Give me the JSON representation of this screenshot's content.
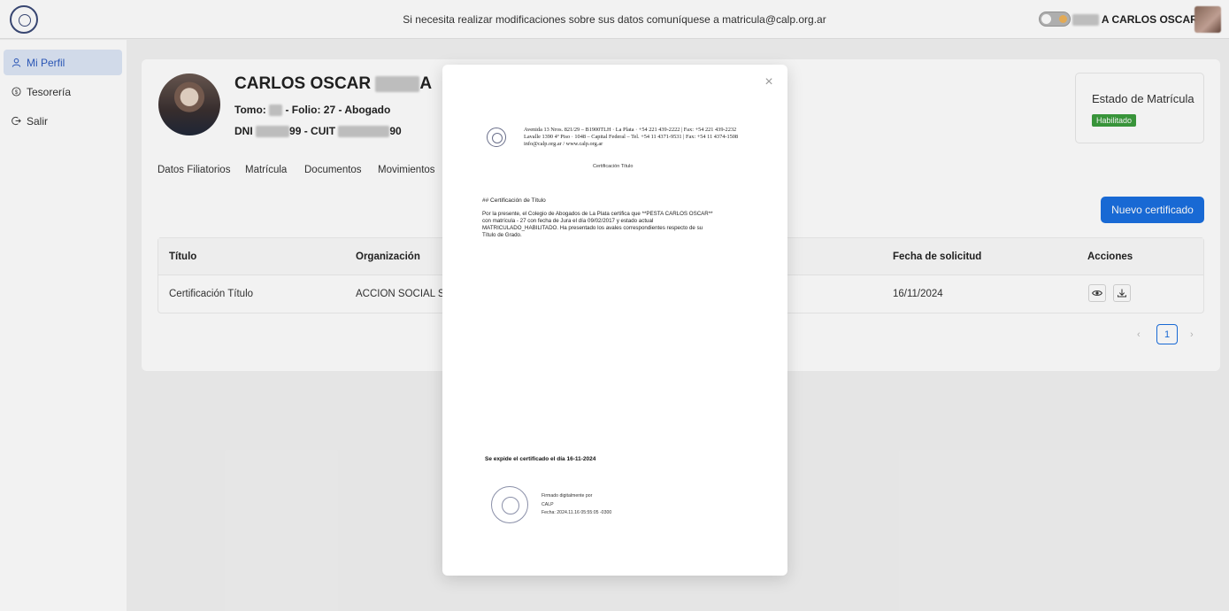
{
  "header": {
    "notice": "Si necesita realizar modificaciones sobre sus datos comuníquese a matricula@calp.org.ar",
    "user_name_suffix": "A CARLOS OSCAR"
  },
  "sidebar": {
    "items": [
      {
        "label": "Mi Perfil",
        "icon": "user-icon"
      },
      {
        "label": "Tesorería",
        "icon": "dollar-icon"
      },
      {
        "label": "Salir",
        "icon": "logout-icon"
      }
    ]
  },
  "profile": {
    "name_start": "CARLOS OSCAR",
    "name_end": "A",
    "tomo_label": "Tomo:",
    "folio_rest": "- Folio: 27 - Abogado",
    "dni_label": "DNI",
    "dni_end": "99 - CUIT",
    "cuit_end": "90"
  },
  "tabs": [
    "Datos Filiatorios",
    "Matrícula",
    "Documentos",
    "Movimientos"
  ],
  "status": {
    "title": "Estado de Matrícula",
    "badge": "Habilitado",
    "badge_color": "#3b9c3e"
  },
  "new_certificate_button": "Nuevo certificado",
  "table": {
    "headers": [
      "Título",
      "Organización",
      "Fecha de solicitud",
      "Acciones"
    ],
    "row": {
      "titulo": "Certificación Título",
      "organizacion": "ACCION SOCIAL SE",
      "fecha": "16/11/2024"
    }
  },
  "pagination": {
    "current": "1",
    "prev": "‹",
    "next": "›"
  },
  "modal": {
    "close": "×",
    "document": {
      "address_line_1": "Avenida 13 Nros. 821/29 – B1900TLH · La Plata · +54 221 439-2222 | Fax: +54 221 439-2232",
      "address_line_2": "Lavalle 1390 4º Piso · 1048 – Capital Federal – Tel. +54 11 4371-9531 | Fax: +54 11 4374-1508",
      "address_line_3": "info@calp.org.ar / www.calp.org.ar",
      "heading": "Certificación Título",
      "subheading": "## Certificación de Título",
      "body_line_1": "Por la presente, el Colegio de Abogados de La Plata certifica que **PESTA  CARLOS OSCAR**",
      "body_line_2": "con matrícula    - 27 con fecha de Jura el día 09/02/2017 y estado actual",
      "body_line_3": "MATRICULADO_HABILITADO. Ha presentado los avales correspondientes respecto de su",
      "body_line_4": "Título de Grado.",
      "expide": "Se expide el certificado el día 16-11-2024",
      "signature_line_1": "Firmado digitalmente por",
      "signature_line_2": "CALP",
      "signature_line_3": "Fecha: 2024.11.16 05:55:05 -0300"
    }
  },
  "colors": {
    "accent": "#1a6fe0",
    "sidebar_active_bg": "#dde6f6"
  }
}
